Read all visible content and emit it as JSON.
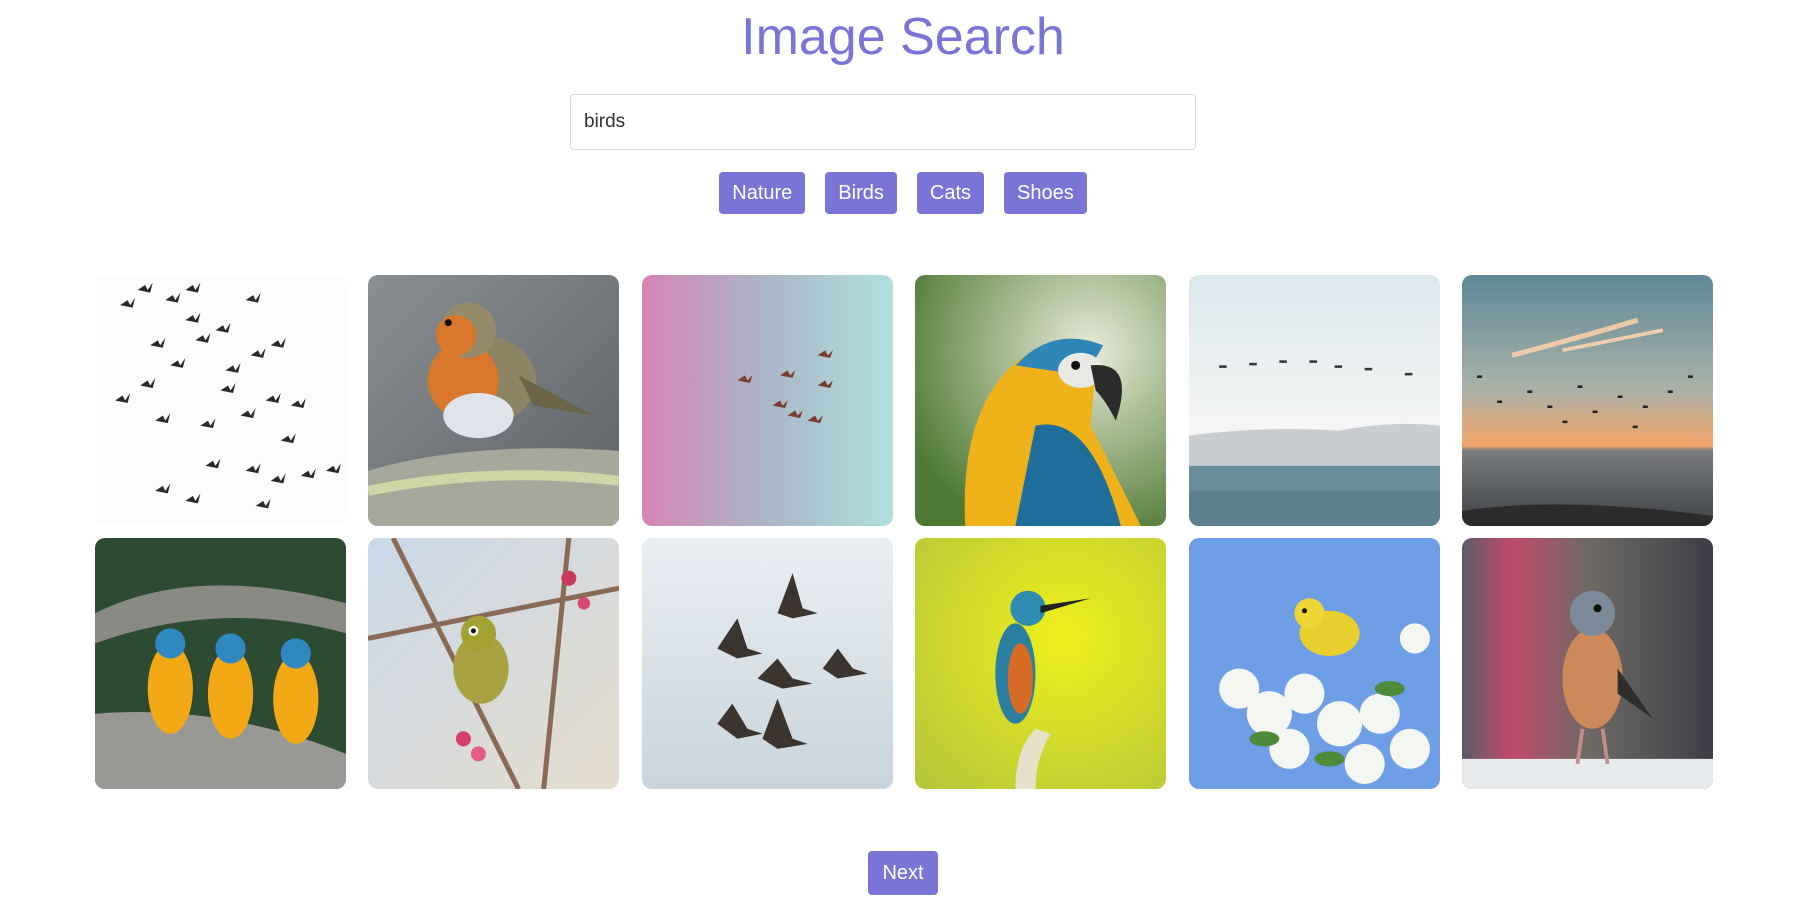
{
  "header": {
    "title": "Image Search"
  },
  "search": {
    "value": "birds"
  },
  "categories": [
    "Nature",
    "Birds",
    "Cats",
    "Shoes"
  ],
  "results": [
    {
      "subject": "flock-of-birds-silhouette"
    },
    {
      "subject": "robin-on-branch"
    },
    {
      "subject": "birds-on-pink-blue-sky"
    },
    {
      "subject": "blue-yellow-macaw"
    },
    {
      "subject": "birds-over-sea"
    },
    {
      "subject": "birds-at-sunset-sea"
    },
    {
      "subject": "three-macaws-on-branch"
    },
    {
      "subject": "white-eye-on-blossom"
    },
    {
      "subject": "geese-in-flight"
    },
    {
      "subject": "kingfisher"
    },
    {
      "subject": "yellow-warbler-in-blossoms"
    },
    {
      "subject": "chaffinch"
    }
  ],
  "pagination": {
    "next_label": "Next"
  },
  "colors": {
    "accent": "#7a74d6"
  }
}
